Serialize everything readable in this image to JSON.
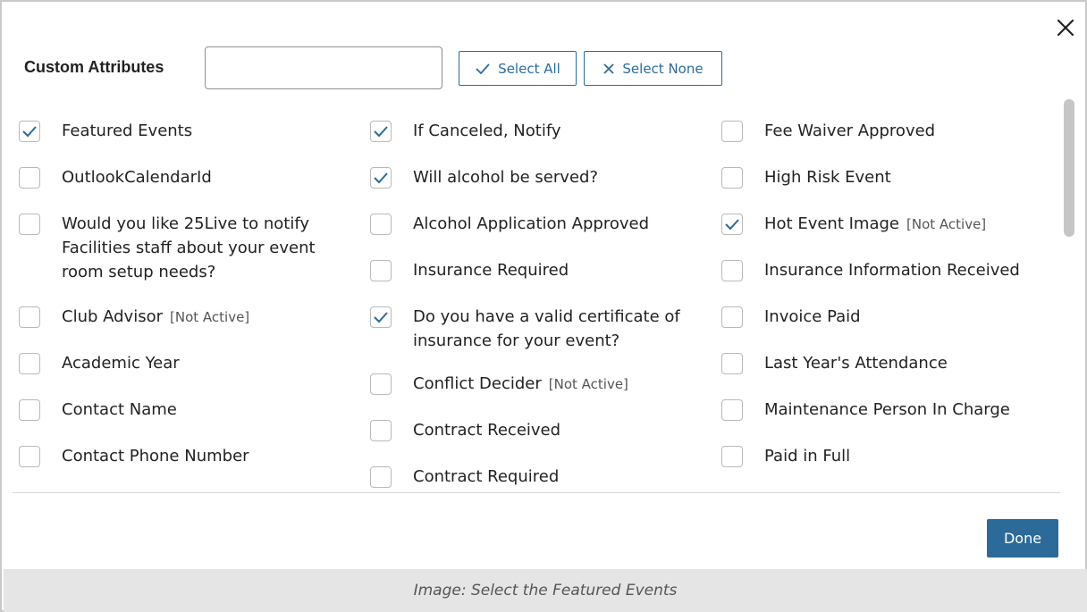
{
  "dialog": {
    "title": "Custom Attributes",
    "search": {
      "value": "",
      "placeholder": ""
    },
    "select_all_label": "Select All",
    "select_none_label": "Select None",
    "done_label": "Done",
    "close_icon": "close-icon"
  },
  "not_active_label": "[Not Active]",
  "columns": [
    [
      {
        "label": "Featured Events",
        "checked": true,
        "not_active": false
      },
      {
        "label": "OutlookCalendarId",
        "checked": false,
        "not_active": false
      },
      {
        "label": "Would you like 25Live to notify Facilities staff about your event room setup needs?",
        "checked": false,
        "not_active": false
      },
      {
        "label": "Club Advisor",
        "checked": false,
        "not_active": true
      },
      {
        "label": "Academic Year",
        "checked": false,
        "not_active": false
      },
      {
        "label": "Contact Name",
        "checked": false,
        "not_active": false
      },
      {
        "label": "Contact Phone Number",
        "checked": false,
        "not_active": false
      }
    ],
    [
      {
        "label": "If Canceled, Notify",
        "checked": true,
        "not_active": false
      },
      {
        "label": "Will alcohol be served?",
        "checked": true,
        "not_active": false
      },
      {
        "label": "Alcohol Application Approved",
        "checked": false,
        "not_active": false
      },
      {
        "label": "Insurance Required",
        "checked": false,
        "not_active": false
      },
      {
        "label": "Do you have a valid certificate of insurance for your event?",
        "checked": true,
        "not_active": false
      },
      {
        "label": "Conflict Decider",
        "checked": false,
        "not_active": true
      },
      {
        "label": "Contract Received",
        "checked": false,
        "not_active": false
      },
      {
        "label": "Contract Required",
        "checked": false,
        "not_active": false
      }
    ],
    [
      {
        "label": "Fee Waiver Approved",
        "checked": false,
        "not_active": false
      },
      {
        "label": "High Risk Event",
        "checked": false,
        "not_active": false
      },
      {
        "label": "Hot Event Image",
        "checked": true,
        "not_active": true
      },
      {
        "label": "Insurance Information Received",
        "checked": false,
        "not_active": false
      },
      {
        "label": "Invoice Paid",
        "checked": false,
        "not_active": false
      },
      {
        "label": "Last Year's Attendance",
        "checked": false,
        "not_active": false
      },
      {
        "label": "Maintenance Person In Charge",
        "checked": false,
        "not_active": false
      },
      {
        "label": "Paid in Full",
        "checked": false,
        "not_active": false
      }
    ]
  ],
  "caption": "Image: Select the Featured Events",
  "colors": {
    "accent": "#2b6a99",
    "checkbox_border": "#b9b9b9",
    "caption_bg": "#e5e5e5"
  }
}
